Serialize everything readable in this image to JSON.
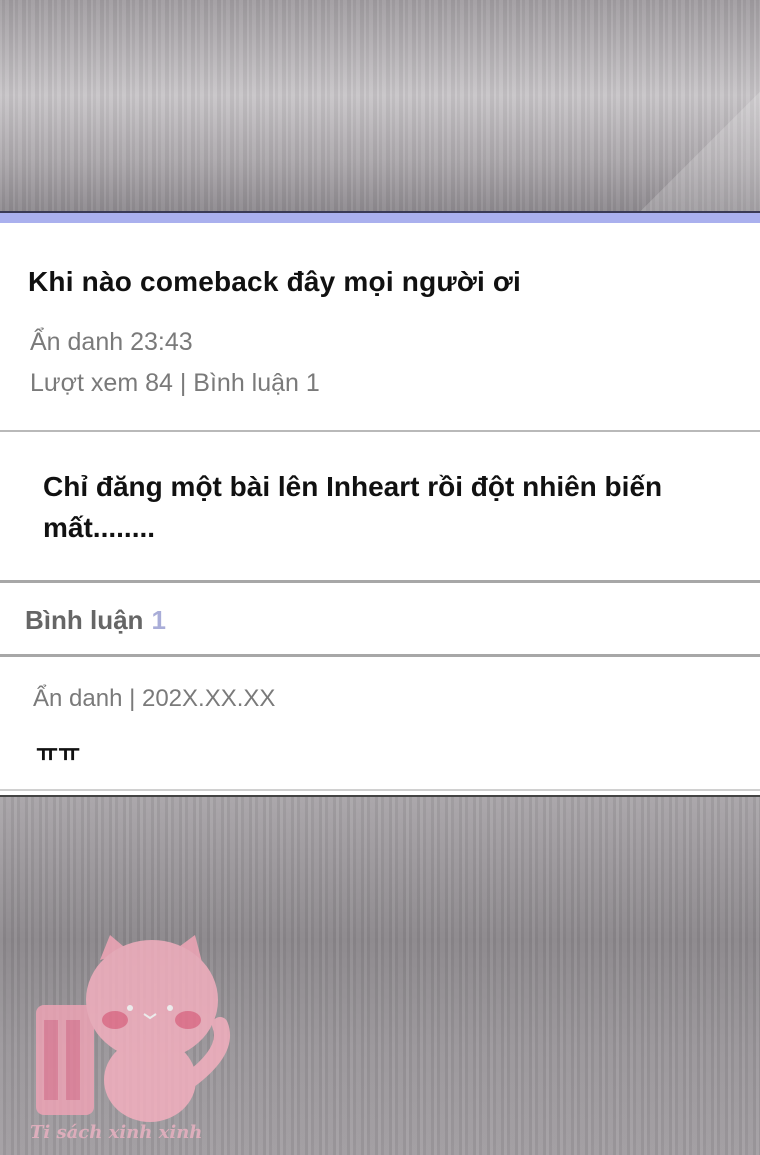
{
  "post": {
    "title": "Khi nào comeback đây mọi người ơi",
    "author_time": "Ẩn danh 23:43",
    "stats": "Lượt xem 84 | Bình luận 1",
    "body": "Chỉ đăng một bài lên Inheart rồi đột nhiên biến mất........"
  },
  "comments": {
    "header_label": "Bình luận",
    "count": "1",
    "items": [
      {
        "meta": "Ẩn danh | 202X.XX.XX",
        "text": "ㅠㅠ"
      }
    ]
  },
  "watermark": {
    "text": "Ti sách xinh xinh"
  },
  "colors": {
    "accent": "#aab0ee",
    "count": "#a9add8",
    "watermark": "#f4a6b8"
  }
}
